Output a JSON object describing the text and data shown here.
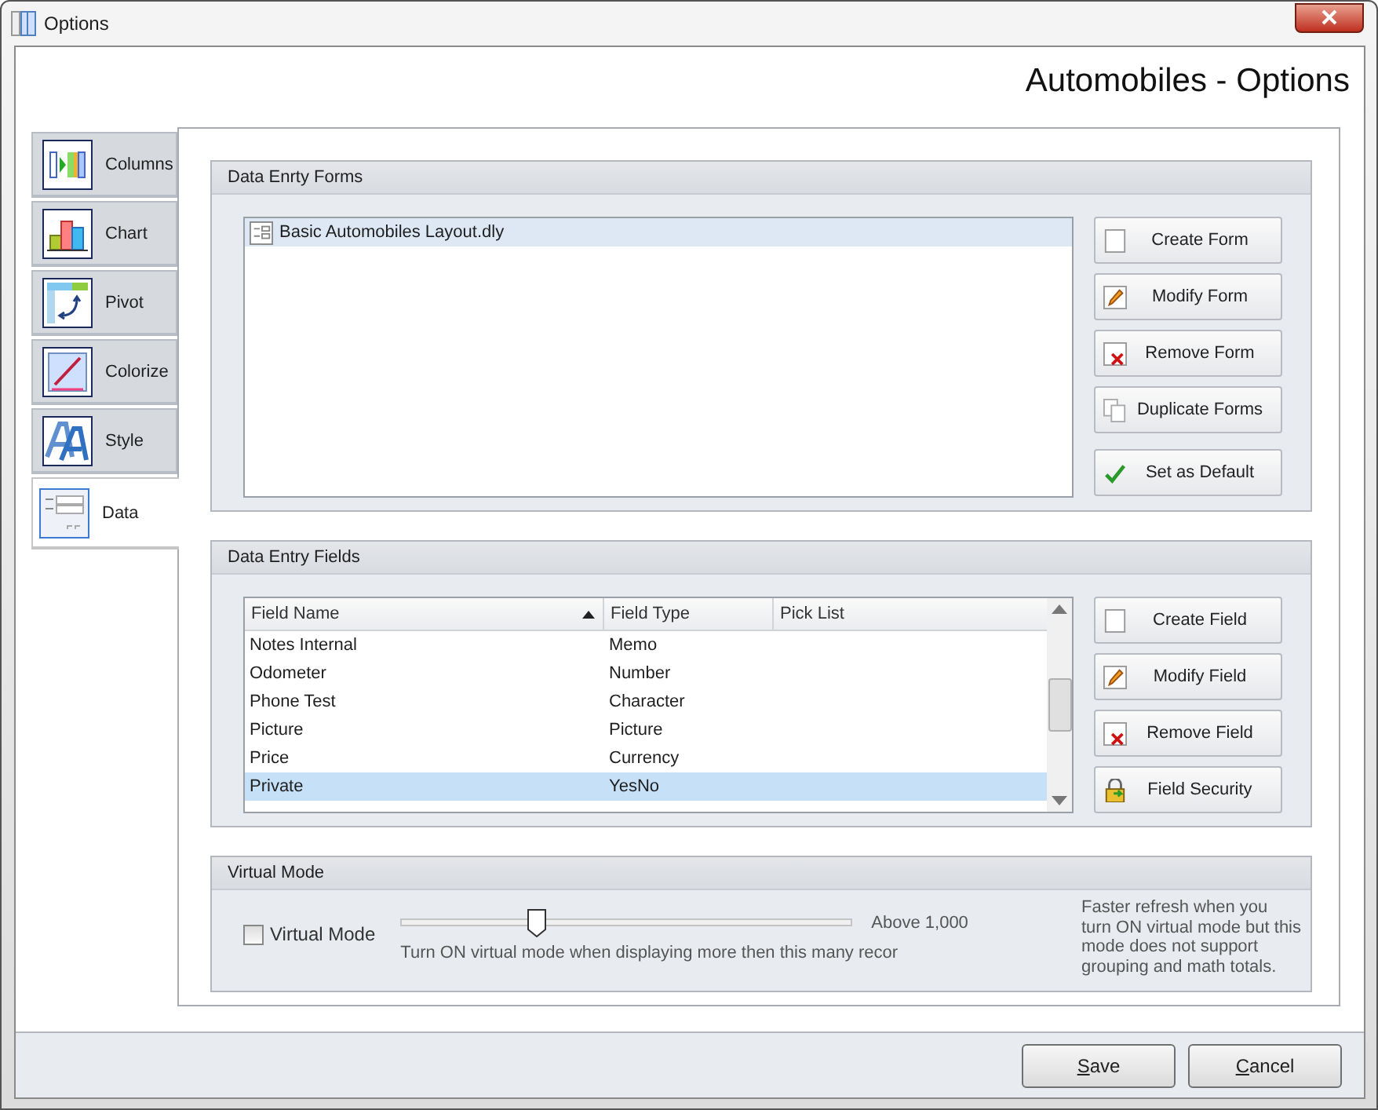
{
  "window": {
    "title": "Options"
  },
  "header": "Automobiles - Options",
  "tabs": [
    {
      "label": "Columns",
      "selected": false
    },
    {
      "label": "Chart",
      "selected": false
    },
    {
      "label": "Pivot",
      "selected": false
    },
    {
      "label": "Colorize",
      "selected": false
    },
    {
      "label": "Style",
      "selected": false
    },
    {
      "label": "Data",
      "selected": true
    }
  ],
  "forms_group": {
    "title": "Data Enrty Forms",
    "items": [
      {
        "label": "Basic Automobiles Layout.dly",
        "selected": true
      }
    ],
    "buttons": [
      "Create Form",
      "Modify Form",
      "Remove Form",
      "Duplicate Forms",
      "Set as Default"
    ]
  },
  "fields_group": {
    "title": "Data Entry Fields",
    "columns": [
      {
        "label": "Field Name",
        "sorted": true
      },
      {
        "label": "Field Type",
        "sorted": false
      },
      {
        "label": "Pick List",
        "sorted": false
      }
    ],
    "rows": [
      {
        "name": "Notes Internal",
        "type": "Memo",
        "selected": false
      },
      {
        "name": "Odometer",
        "type": "Number",
        "selected": false
      },
      {
        "name": "Phone Test",
        "type": "Character",
        "selected": false
      },
      {
        "name": "Picture",
        "type": "Picture",
        "selected": false
      },
      {
        "name": "Price",
        "type": "Currency",
        "selected": false
      },
      {
        "name": "Private",
        "type": "YesNo",
        "selected": true
      }
    ],
    "buttons": [
      "Create Field",
      "Modify Field",
      "Remove Field",
      "Field Security"
    ]
  },
  "virtual_group": {
    "title": "Virtual Mode",
    "checkbox": {
      "label": "Virtual Mode",
      "checked": false
    },
    "slider": {
      "level": 0.3
    },
    "reading": "Above 1,000",
    "caption": "Turn ON virtual mode when displaying more then this many recor",
    "note": "Faster refresh when you turn ON virtual mode but this mode does not support grouping and math totals."
  },
  "footer_buttons": [
    "Save",
    "Cancel"
  ]
}
